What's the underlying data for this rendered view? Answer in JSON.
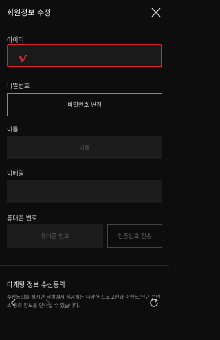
{
  "header": {
    "title": "회원정보 수정",
    "close_icon": "close-icon"
  },
  "fields": {
    "id_label": "아이디",
    "password_label": "비밀번호",
    "password_change": "비밀번호 변경",
    "name_label": "이름",
    "name_placeholder": "이름",
    "email_label": "이메일",
    "phone_label": "휴대폰 번호",
    "phone_placeholder": "휴대폰 번호",
    "verify_button": "인증번호 전송"
  },
  "marketing": {
    "title": "마케팅 정보 수신동의",
    "description": "수신동의를 하시면 티빙에서 제공하는 다양한 프로모션과 이벤트/신규 콘텐츠 등의 정보를 만나실 수 있습니다."
  },
  "colors": {
    "accent": "#e0202e",
    "background": "#0d0d0d"
  },
  "browser_nav": {
    "back_icon": "back-icon",
    "forward_icon": "forward-icon",
    "reload_icon": "reload-icon"
  }
}
